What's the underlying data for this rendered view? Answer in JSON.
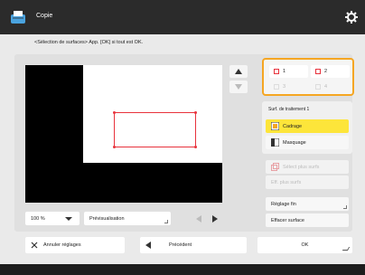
{
  "header": {
    "title": "Copie"
  },
  "instruction": "<Sélection de surfaces> App. [OK] si tout est OK.",
  "faces": [
    {
      "label": "1",
      "selected": true
    },
    {
      "label": "2",
      "selected": true
    },
    {
      "label": "3",
      "selected": false
    },
    {
      "label": "4",
      "selected": false
    }
  ],
  "subpanel": {
    "title": "Surf. de traitement 1",
    "framing_label": "Cadrage",
    "masking_label": "Masquage",
    "select_multiple_label": "Sélect plus surfs",
    "clear_multiple_label": "Eff. plus surfs",
    "fine_adjust_label": "Réglage fin",
    "erase_surface_label": "Effacer surface"
  },
  "preview": {
    "zoom_value": "100 %",
    "preview_label": "Prévisualisation"
  },
  "footer": {
    "cancel_label": "Annuler réglages",
    "back_label": "Précédent",
    "ok_label": "OK"
  },
  "colors": {
    "accent": "#f5a623",
    "active_button": "#fde53a",
    "selection_outline": "#e8323c"
  }
}
